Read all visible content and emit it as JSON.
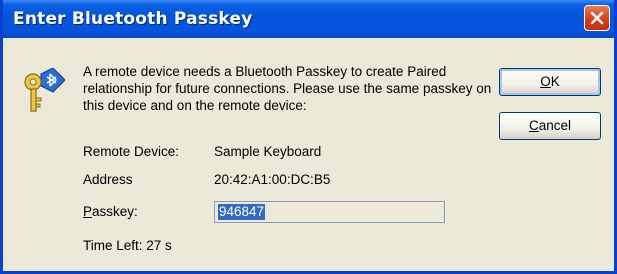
{
  "window": {
    "title": "Enter Bluetooth Passkey",
    "close_icon": "close-icon"
  },
  "message": "A remote device needs a Bluetooth Passkey to create Paired relationship for future connections. Please use the same passkey on this device and on the remote device:",
  "icon": "bluetooth-key-icon",
  "fields": {
    "remote_device_label": "Remote Device:",
    "remote_device_value": "Sample Keyboard",
    "address_label": "Address",
    "address_value": "20:42:A1:00:DC:B5",
    "passkey_label_key": "P",
    "passkey_label_rest": "asskey:",
    "passkey_value": "946847",
    "time_left": "Time Left: 27 s"
  },
  "buttons": {
    "ok_key": "O",
    "ok_rest": "K",
    "cancel_key": "C",
    "cancel_rest": "ancel"
  },
  "colors": {
    "titlebar": "#0554d8",
    "close": "#d63b12",
    "selection": "#316ac5",
    "dialog_bg": "#ece9d8"
  }
}
